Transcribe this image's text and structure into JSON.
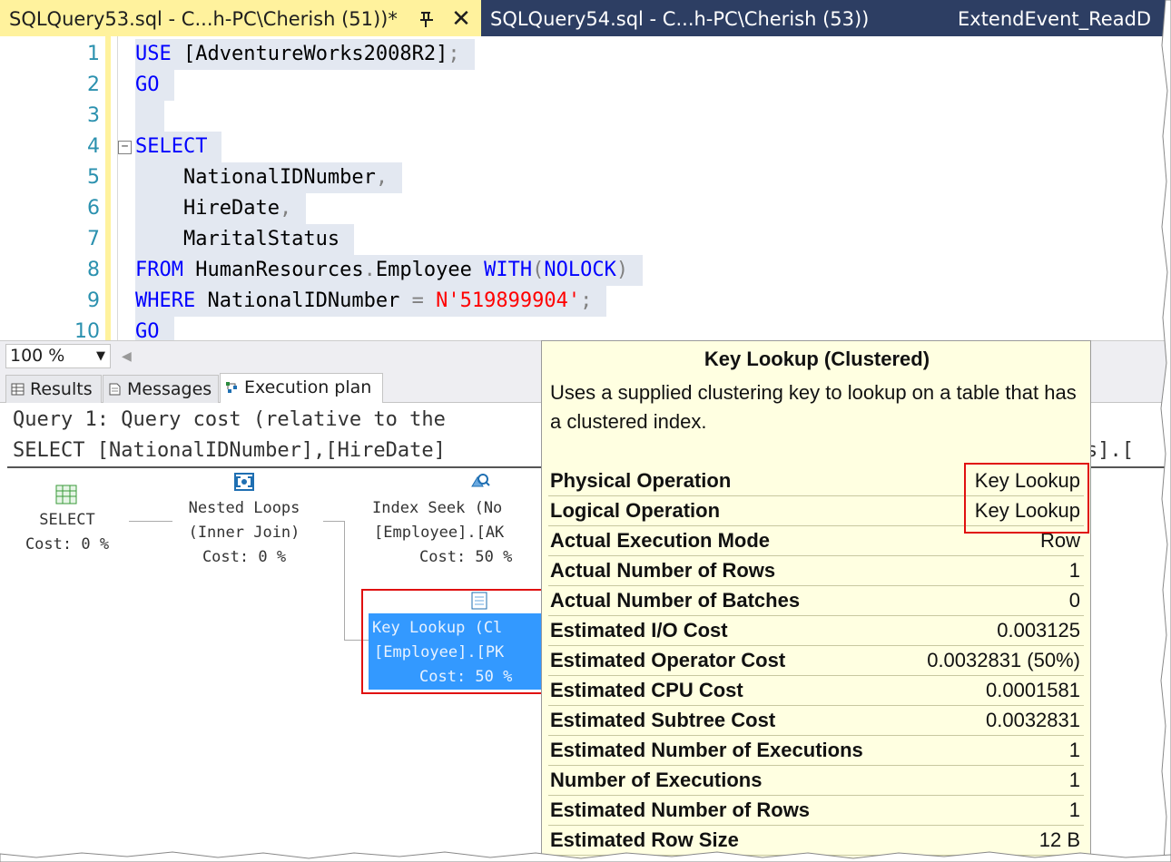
{
  "tabs": [
    {
      "label": "SQLQuery53.sql - C...h-PC\\Cherish (51))*",
      "active": true
    },
    {
      "label": "SQLQuery54.sql - C...h-PC\\Cherish (53))",
      "active": false
    },
    {
      "label": "ExtendEvent_ReadD",
      "active": false
    }
  ],
  "editor": {
    "line_numbers": [
      "1",
      "2",
      "3",
      "4",
      "5",
      "6",
      "7",
      "8",
      "9",
      "10"
    ],
    "l1": {
      "kw": "USE",
      "rest": " [AdventureWorks2008R2]",
      "semi": ";"
    },
    "l2": {
      "kw": "GO"
    },
    "l4": {
      "kw": "SELECT"
    },
    "l5": {
      "ident": "    NationalIDNumber",
      "comma": ","
    },
    "l6": {
      "ident": "    HireDate",
      "comma": ","
    },
    "l7": {
      "ident": "    MaritalStatus"
    },
    "l8": {
      "kw1": "FROM",
      "ident1": " HumanResources",
      "dot": ".",
      "ident2": "Employee ",
      "kw2": "WITH",
      "p1": "(",
      "kw3": "NOLOCK",
      "p2": ")"
    },
    "l9": {
      "kw": "WHERE",
      "ident": " NationalIDNumber ",
      "op": "=",
      "sp": " ",
      "str": "N'519899904'",
      "semi": ";"
    },
    "l10": {
      "kw": "GO"
    }
  },
  "zoom": {
    "value": "100 %"
  },
  "result_tabs": [
    {
      "label": "Results"
    },
    {
      "label": "Messages"
    },
    {
      "label": "Execution plan"
    }
  ],
  "plan": {
    "query_line": "Query 1: Query cost (relative to the",
    "select_line": "SELECT [NationalIDNumber],[HireDate]",
    "select_line_tail": "s].[",
    "ops": {
      "select": {
        "name": "SELECT",
        "cost": "Cost: 0 %"
      },
      "nested": {
        "name": "Nested Loops",
        "sub": "(Inner Join)",
        "cost": "Cost: 0 %"
      },
      "seek": {
        "name": "Index Seek (No",
        "sub": "[Employee].[AK",
        "cost": "Cost: 50 %"
      },
      "lookup": {
        "name": "Key Lookup (Cl",
        "sub": "[Employee].[PK",
        "cost": "Cost: 50 %"
      }
    }
  },
  "tooltip": {
    "title": "Key Lookup (Clustered)",
    "description": "Uses a supplied clustering key to lookup on a table that has a clustered index.",
    "rows": [
      {
        "k": "Physical Operation",
        "v": "Key Lookup"
      },
      {
        "k": "Logical Operation",
        "v": "Key Lookup"
      },
      {
        "k": "Actual Execution Mode",
        "v": "Row"
      },
      {
        "k": "Actual Number of Rows",
        "v": "1"
      },
      {
        "k": "Actual Number of Batches",
        "v": "0"
      },
      {
        "k": "Estimated I/O Cost",
        "v": "0.003125"
      },
      {
        "k": "Estimated Operator Cost",
        "v": "0.0032831 (50%)"
      },
      {
        "k": "Estimated CPU Cost",
        "v": "0.0001581"
      },
      {
        "k": "Estimated Subtree Cost",
        "v": "0.0032831"
      },
      {
        "k": "Estimated Number of Executions",
        "v": "1"
      },
      {
        "k": "Number of Executions",
        "v": "1"
      },
      {
        "k": "Estimated Number of Rows",
        "v": "1"
      },
      {
        "k": "Estimated Row Size",
        "v": "12 B"
      }
    ]
  },
  "colors": {
    "tab_active_bg": "#fff29d",
    "tabstrip_bg": "#2d3e63",
    "keyword": "#0000ff",
    "string": "#ff0000",
    "line_number": "#2b91af",
    "tooltip_bg": "#ffffe1",
    "selection": "#3399ff",
    "highlight_box": "#e01010"
  }
}
